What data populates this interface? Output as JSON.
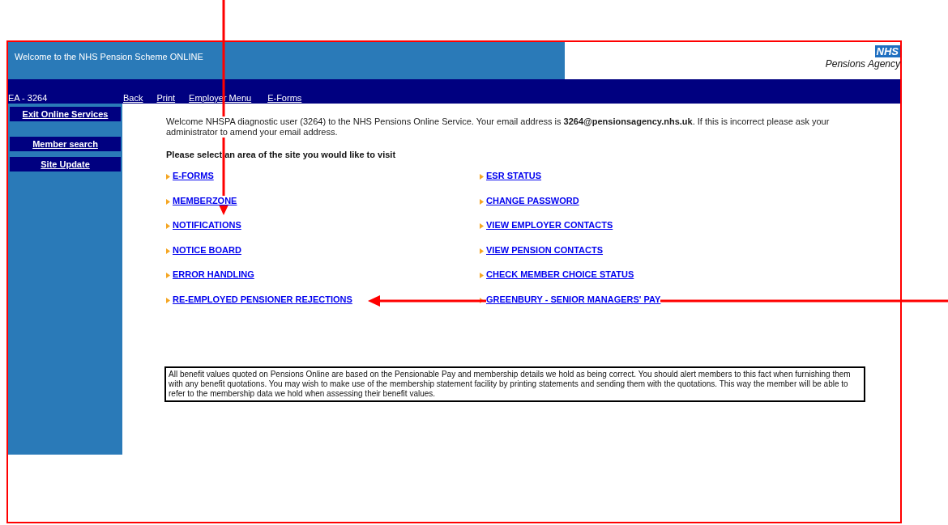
{
  "header": {
    "title": "Welcome to the NHS Pension Scheme ONLINE",
    "logo_badge": "NHS",
    "logo_subtitle": "Pensions Agency"
  },
  "nav": {
    "user": "EA - 3264",
    "links": [
      "Back",
      "Print",
      "Employer Menu",
      "E-Forms"
    ]
  },
  "sidebar": {
    "items": [
      "Exit Online Services",
      "Member search",
      "Site Update"
    ]
  },
  "welcome": "Welcome NHSPA diagnostic user (3264) to the NHS Pensions Online Service. Your email address is **3264@pensionsagency.nhs.uk**. If this is incorrect please ask your administrator to amend your email address.",
  "prompt": "Please select an area of the site you would like to visit",
  "link_columns": [
    [
      "E-FORMS",
      "MEMBERZONE",
      "NOTIFICATIONS",
      "NOTICE BOARD",
      "ERROR HANDLING",
      "RE-EMPLOYED PENSIONER REJECTIONS"
    ],
    [
      "ESR STATUS",
      "CHANGE PASSWORD",
      "VIEW EMPLOYER CONTACTS",
      "VIEW PENSION CONTACTS",
      "CHECK MEMBER CHOICE STATUS",
      "GREENBURY - SENIOR MANAGERS' PAY"
    ]
  ],
  "notice": "All benefit values quoted on Pensions Online are based on the Pensionable Pay and membership details we hold as being correct. You should alert members to this fact when furnishing them with any benefit quotations. You may wish to make use of the membership statement facility by printing statements and sending them with the quotations. This way the member will be able to refer to the membership data we hold when assessing their benefit values."
}
